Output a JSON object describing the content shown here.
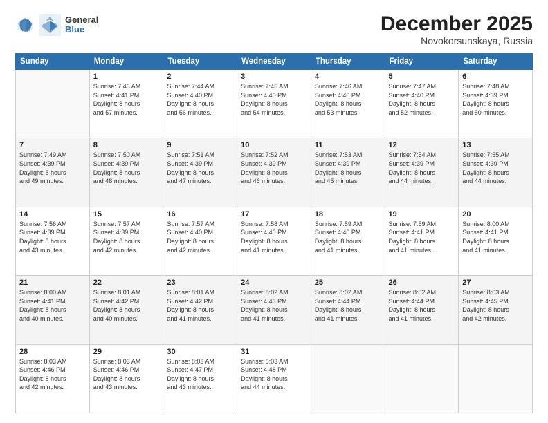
{
  "header": {
    "logo_general": "General",
    "logo_blue": "Blue",
    "month_title": "December 2025",
    "location": "Novokorsunskaya, Russia"
  },
  "days_of_week": [
    "Sunday",
    "Monday",
    "Tuesday",
    "Wednesday",
    "Thursday",
    "Friday",
    "Saturday"
  ],
  "weeks": [
    [
      {
        "day": "",
        "content": ""
      },
      {
        "day": "1",
        "content": "Sunrise: 7:43 AM\nSunset: 4:41 PM\nDaylight: 8 hours\nand 57 minutes."
      },
      {
        "day": "2",
        "content": "Sunrise: 7:44 AM\nSunset: 4:40 PM\nDaylight: 8 hours\nand 56 minutes."
      },
      {
        "day": "3",
        "content": "Sunrise: 7:45 AM\nSunset: 4:40 PM\nDaylight: 8 hours\nand 54 minutes."
      },
      {
        "day": "4",
        "content": "Sunrise: 7:46 AM\nSunset: 4:40 PM\nDaylight: 8 hours\nand 53 minutes."
      },
      {
        "day": "5",
        "content": "Sunrise: 7:47 AM\nSunset: 4:40 PM\nDaylight: 8 hours\nand 52 minutes."
      },
      {
        "day": "6",
        "content": "Sunrise: 7:48 AM\nSunset: 4:39 PM\nDaylight: 8 hours\nand 50 minutes."
      }
    ],
    [
      {
        "day": "7",
        "content": "Sunrise: 7:49 AM\nSunset: 4:39 PM\nDaylight: 8 hours\nand 49 minutes."
      },
      {
        "day": "8",
        "content": "Sunrise: 7:50 AM\nSunset: 4:39 PM\nDaylight: 8 hours\nand 48 minutes."
      },
      {
        "day": "9",
        "content": "Sunrise: 7:51 AM\nSunset: 4:39 PM\nDaylight: 8 hours\nand 47 minutes."
      },
      {
        "day": "10",
        "content": "Sunrise: 7:52 AM\nSunset: 4:39 PM\nDaylight: 8 hours\nand 46 minutes."
      },
      {
        "day": "11",
        "content": "Sunrise: 7:53 AM\nSunset: 4:39 PM\nDaylight: 8 hours\nand 45 minutes."
      },
      {
        "day": "12",
        "content": "Sunrise: 7:54 AM\nSunset: 4:39 PM\nDaylight: 8 hours\nand 44 minutes."
      },
      {
        "day": "13",
        "content": "Sunrise: 7:55 AM\nSunset: 4:39 PM\nDaylight: 8 hours\nand 44 minutes."
      }
    ],
    [
      {
        "day": "14",
        "content": "Sunrise: 7:56 AM\nSunset: 4:39 PM\nDaylight: 8 hours\nand 43 minutes."
      },
      {
        "day": "15",
        "content": "Sunrise: 7:57 AM\nSunset: 4:39 PM\nDaylight: 8 hours\nand 42 minutes."
      },
      {
        "day": "16",
        "content": "Sunrise: 7:57 AM\nSunset: 4:40 PM\nDaylight: 8 hours\nand 42 minutes."
      },
      {
        "day": "17",
        "content": "Sunrise: 7:58 AM\nSunset: 4:40 PM\nDaylight: 8 hours\nand 41 minutes."
      },
      {
        "day": "18",
        "content": "Sunrise: 7:59 AM\nSunset: 4:40 PM\nDaylight: 8 hours\nand 41 minutes."
      },
      {
        "day": "19",
        "content": "Sunrise: 7:59 AM\nSunset: 4:41 PM\nDaylight: 8 hours\nand 41 minutes."
      },
      {
        "day": "20",
        "content": "Sunrise: 8:00 AM\nSunset: 4:41 PM\nDaylight: 8 hours\nand 41 minutes."
      }
    ],
    [
      {
        "day": "21",
        "content": "Sunrise: 8:00 AM\nSunset: 4:41 PM\nDaylight: 8 hours\nand 40 minutes."
      },
      {
        "day": "22",
        "content": "Sunrise: 8:01 AM\nSunset: 4:42 PM\nDaylight: 8 hours\nand 40 minutes."
      },
      {
        "day": "23",
        "content": "Sunrise: 8:01 AM\nSunset: 4:42 PM\nDaylight: 8 hours\nand 41 minutes."
      },
      {
        "day": "24",
        "content": "Sunrise: 8:02 AM\nSunset: 4:43 PM\nDaylight: 8 hours\nand 41 minutes."
      },
      {
        "day": "25",
        "content": "Sunrise: 8:02 AM\nSunset: 4:44 PM\nDaylight: 8 hours\nand 41 minutes."
      },
      {
        "day": "26",
        "content": "Sunrise: 8:02 AM\nSunset: 4:44 PM\nDaylight: 8 hours\nand 41 minutes."
      },
      {
        "day": "27",
        "content": "Sunrise: 8:03 AM\nSunset: 4:45 PM\nDaylight: 8 hours\nand 42 minutes."
      }
    ],
    [
      {
        "day": "28",
        "content": "Sunrise: 8:03 AM\nSunset: 4:46 PM\nDaylight: 8 hours\nand 42 minutes."
      },
      {
        "day": "29",
        "content": "Sunrise: 8:03 AM\nSunset: 4:46 PM\nDaylight: 8 hours\nand 43 minutes."
      },
      {
        "day": "30",
        "content": "Sunrise: 8:03 AM\nSunset: 4:47 PM\nDaylight: 8 hours\nand 43 minutes."
      },
      {
        "day": "31",
        "content": "Sunrise: 8:03 AM\nSunset: 4:48 PM\nDaylight: 8 hours\nand 44 minutes."
      },
      {
        "day": "",
        "content": ""
      },
      {
        "day": "",
        "content": ""
      },
      {
        "day": "",
        "content": ""
      }
    ]
  ]
}
